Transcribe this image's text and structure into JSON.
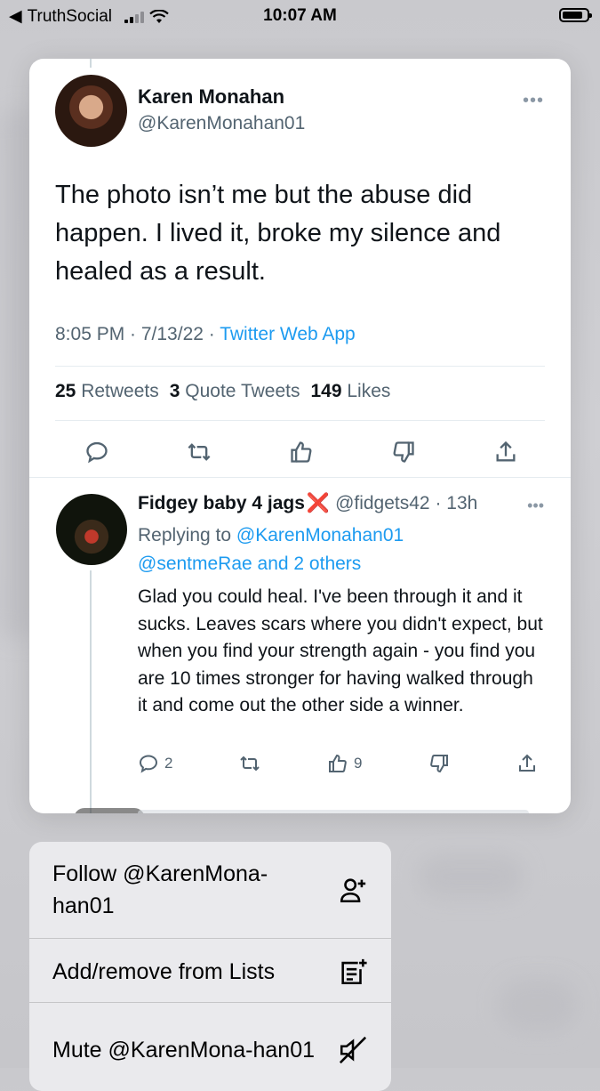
{
  "status_bar": {
    "back_app": "TruthSocial",
    "time": "10:07 AM"
  },
  "main_tweet": {
    "author_name": "Karen Monahan",
    "author_handle": "@KarenMonahan01",
    "text": "The photo isn’t me but the abuse did happen. I lived it, broke my silence and healed as a result.",
    "time": "8:05 PM · 7/13/22 · ",
    "source": "Twitter Web App",
    "retweets_count": "25",
    "retweets_label": "Retweets",
    "quotes_count": "3",
    "quotes_label": "Quote Tweets",
    "likes_count": "149",
    "likes_label": "Likes",
    "more_icon": "ellipsis-icon"
  },
  "reply": {
    "author_name": "Fidgey baby 4 jags",
    "author_emoji": "❌",
    "author_handle": "@fidgets42",
    "age": " · 13h",
    "replying_prefix": "Replying to ",
    "replying_to": "@KarenMonahan01",
    "replying_others": "@sentmeRae and 2 others",
    "text": "Glad you could heal.  I've been through it and it sucks.  Leaves scars where you didn't expect, but when you find your strength again - you find you are 10 times stronger for having walked through it and come out the other side a winner.",
    "reply_count": "2",
    "like_count": "9"
  },
  "context_menu": {
    "items": [
      {
        "label": "Follow @KarenMona-han01",
        "icon": "follow-user-icon"
      },
      {
        "label": "Add/remove from Lists",
        "icon": "list-add-icon"
      },
      {
        "label": "Mute @KarenMona-han01",
        "icon": "mute-icon"
      }
    ]
  }
}
